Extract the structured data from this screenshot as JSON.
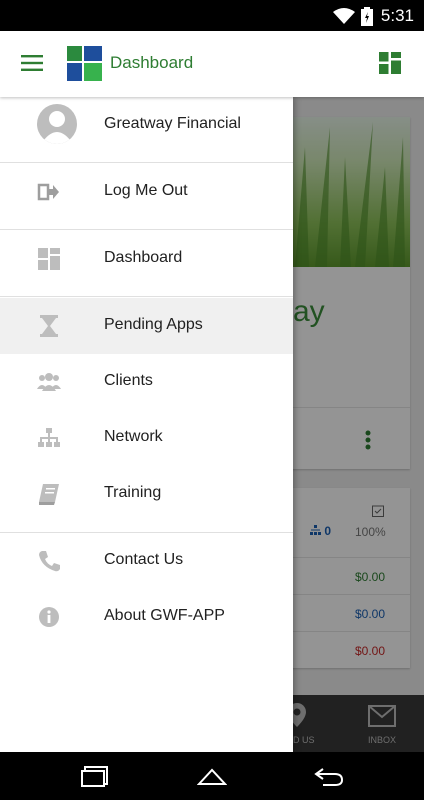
{
  "status_bar": {
    "time": "5:31"
  },
  "app_bar": {
    "title": "Dashboard"
  },
  "drawer": {
    "profile_name": "Greatway Financial",
    "items": [
      {
        "label": "Log Me Out",
        "icon": "logout-icon"
      },
      {
        "label": "Dashboard",
        "icon": "dashboard-icon"
      },
      {
        "label": "Pending Apps",
        "icon": "hourglass-icon",
        "active": true
      },
      {
        "label": "Clients",
        "icon": "users-icon"
      },
      {
        "label": "Network",
        "icon": "sitemap-icon"
      },
      {
        "label": "Training",
        "icon": "book-icon"
      },
      {
        "label": "Contact Us",
        "icon": "phone-icon"
      },
      {
        "label": "About GWF-APP",
        "icon": "info-icon"
      }
    ]
  },
  "background": {
    "welcome_partial": "ay",
    "network_count": "0",
    "percent": "100%",
    "amounts": [
      "$0.00",
      "$0.00",
      "$0.00"
    ],
    "nav_labels": [
      "D US",
      "INBOX"
    ]
  },
  "colors": {
    "brand_green": "#2e7d32",
    "amount_green": "#2e7d32",
    "amount_blue": "#1a5fb4",
    "amount_red": "#c62828"
  }
}
